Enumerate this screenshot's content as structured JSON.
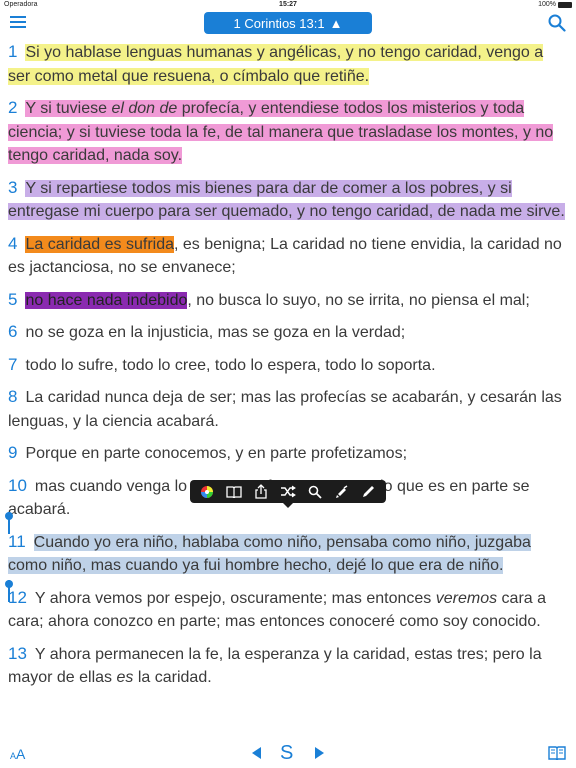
{
  "status": {
    "carrier": "Operadora",
    "time": "15:27",
    "battery": "100%"
  },
  "nav": {
    "reference": "1 Corintios 13:1",
    "reference_arrow": "▲"
  },
  "verses": [
    {
      "num": "1",
      "segments": [
        {
          "text": "Si yo hablase lenguas humanas y angélicas, y no tengo caridad, vengo a ser como metal que resuena, o címbalo que retiñe.",
          "hl": "yellow"
        }
      ]
    },
    {
      "num": "2",
      "segments": [
        {
          "text": "Y si tuviese ",
          "hl": "pink"
        },
        {
          "text": "el don de",
          "hl": "pink",
          "italic": true
        },
        {
          "text": " profecía, y entendiese todos los misterios y toda ciencia; y si tuviese toda la fe, de tal manera que trasladase los montes, y no tengo caridad, nada soy.",
          "hl": "pink"
        }
      ]
    },
    {
      "num": "3",
      "segments": [
        {
          "text": "Y si repartiese todos mis bienes para dar de comer a los pobres, y si entregase mi cuerpo para ser quemado, y no tengo caridad, de nada me sirve.",
          "hl": "purple"
        }
      ]
    },
    {
      "num": "4",
      "segments": [
        {
          "text": "La caridad es sufrida",
          "hl": "orange"
        },
        {
          "text": ", es benigna; La caridad no tiene envidia, la caridad no es jactanciosa, no se envanece;"
        }
      ]
    },
    {
      "num": "5",
      "segments": [
        {
          "text": "no hace nada indebido",
          "hl": "violet"
        },
        {
          "text": ", no busca lo suyo, no se irrita, no piensa el mal;"
        }
      ]
    },
    {
      "num": "6",
      "segments": [
        {
          "text": "no se goza en la injusticia, mas se goza en la verdad;"
        }
      ]
    },
    {
      "num": "7",
      "segments": [
        {
          "text": "todo lo sufre, todo lo cree, todo lo espera, todo lo soporta."
        }
      ]
    },
    {
      "num": "8",
      "segments": [
        {
          "text": "La caridad nunca deja de ser; mas las profecías se acabarán, y cesarán las lenguas, y la ciencia acabará."
        }
      ]
    },
    {
      "num": "9",
      "segments": [
        {
          "text": "Porque en parte conocemos, y en parte profetizamos;"
        }
      ]
    },
    {
      "num": "10",
      "segments": [
        {
          "text": "mas cuando venga lo que es perfecto, entonces lo que es en parte se acabará."
        }
      ]
    },
    {
      "num": "11",
      "segments": [
        {
          "text": "Cuando yo era niño, hablaba como niño, pensaba como niño, juzgaba como niño, mas cuando ya fui hombre hecho, dejé lo que era de niño.",
          "hl": "blue"
        }
      ]
    },
    {
      "num": "12",
      "segments": [
        {
          "text": "Y ahora vemos por espejo, oscuramente; mas entonces "
        },
        {
          "text": "veremos",
          "italic": true
        },
        {
          "text": " cara a cara; ahora conozco en parte; mas entonces conoceré como soy conocido."
        }
      ]
    },
    {
      "num": "13",
      "segments": [
        {
          "text": "Y ahora permanecen la fe, la esperanza y la caridad, estas tres; pero la mayor de ellas "
        },
        {
          "text": "es",
          "italic": true
        },
        {
          "text": " la caridad."
        }
      ]
    }
  ],
  "toolbar": {
    "icons": [
      "color-wheel-icon",
      "book-open-icon",
      "share-icon",
      "shuffle-icon",
      "search-icon",
      "highlighter-icon",
      "pen-icon"
    ]
  },
  "bottom": {
    "font_label_small": "A",
    "font_label_large": "A",
    "center_label": "S"
  },
  "colors": {
    "accent": "#1a7fd6",
    "yellow": "#f4f28a",
    "pink": "#f09ad6",
    "purple": "#c8aee8",
    "orange": "#f38a1c",
    "violet": "#8a2ab0",
    "blue": "#bfd2e8"
  }
}
